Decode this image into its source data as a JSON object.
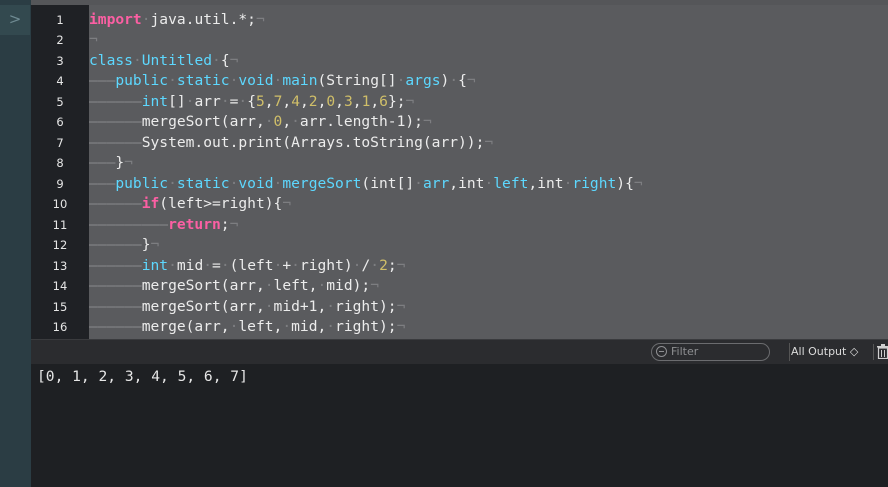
{
  "left_rail": {
    "toggle_glyph": ">"
  },
  "editor": {
    "line_numbers": [
      "1",
      "2",
      "3",
      "4",
      "5",
      "6",
      "7",
      "8",
      "9",
      "10",
      "11",
      "12",
      "13",
      "14",
      "15",
      "16"
    ],
    "lines": [
      [
        {
          "t": "import",
          "c": "kw"
        },
        {
          "t": "·",
          "c": "inv"
        },
        {
          "t": "java.util.*;",
          "c": ""
        },
        {
          "t": "¬",
          "c": "inv"
        }
      ],
      [
        {
          "t": "¬",
          "c": "inv"
        }
      ],
      [
        {
          "t": "class",
          "c": "kw2"
        },
        {
          "t": "·",
          "c": "inv"
        },
        {
          "t": "Untitled",
          "c": "kw2"
        },
        {
          "t": "·",
          "c": "inv"
        },
        {
          "t": "{",
          "c": ""
        },
        {
          "t": "¬",
          "c": "inv"
        }
      ],
      [
        {
          "t": "———",
          "c": "guide"
        },
        {
          "t": "public",
          "c": "kw2"
        },
        {
          "t": "·",
          "c": "inv"
        },
        {
          "t": "static",
          "c": "kw2"
        },
        {
          "t": "·",
          "c": "inv"
        },
        {
          "t": "void",
          "c": "kw2"
        },
        {
          "t": "·",
          "c": "inv"
        },
        {
          "t": "main",
          "c": "kw2"
        },
        {
          "t": "(String[]",
          "c": ""
        },
        {
          "t": "·",
          "c": "inv"
        },
        {
          "t": "args",
          "c": "kw2"
        },
        {
          "t": ")",
          "c": ""
        },
        {
          "t": "·",
          "c": "inv"
        },
        {
          "t": "{",
          "c": ""
        },
        {
          "t": "¬",
          "c": "inv"
        }
      ],
      [
        {
          "t": "——————",
          "c": "guide"
        },
        {
          "t": "int",
          "c": "kw2"
        },
        {
          "t": "[]",
          "c": ""
        },
        {
          "t": "·",
          "c": "inv"
        },
        {
          "t": "arr",
          "c": ""
        },
        {
          "t": "·",
          "c": "inv"
        },
        {
          "t": "=",
          "c": ""
        },
        {
          "t": "·",
          "c": "inv"
        },
        {
          "t": "{",
          "c": ""
        },
        {
          "t": "5",
          "c": "num-lit"
        },
        {
          "t": ",",
          "c": ""
        },
        {
          "t": "7",
          "c": "num-lit"
        },
        {
          "t": ",",
          "c": ""
        },
        {
          "t": "4",
          "c": "num-lit"
        },
        {
          "t": ",",
          "c": ""
        },
        {
          "t": "2",
          "c": "num-lit"
        },
        {
          "t": ",",
          "c": ""
        },
        {
          "t": "0",
          "c": "num-lit"
        },
        {
          "t": ",",
          "c": ""
        },
        {
          "t": "3",
          "c": "num-lit"
        },
        {
          "t": ",",
          "c": ""
        },
        {
          "t": "1",
          "c": "num-lit"
        },
        {
          "t": ",",
          "c": ""
        },
        {
          "t": "6",
          "c": "num-lit"
        },
        {
          "t": "};",
          "c": ""
        },
        {
          "t": "¬",
          "c": "inv"
        }
      ],
      [
        {
          "t": "——————",
          "c": "guide"
        },
        {
          "t": "mergeSort(arr,",
          "c": ""
        },
        {
          "t": "·",
          "c": "inv"
        },
        {
          "t": "0",
          "c": "num-lit"
        },
        {
          "t": ",",
          "c": ""
        },
        {
          "t": "·",
          "c": "inv"
        },
        {
          "t": "arr.length-1);",
          "c": ""
        },
        {
          "t": "¬",
          "c": "inv"
        }
      ],
      [
        {
          "t": "——————",
          "c": "guide"
        },
        {
          "t": "System.out.print(Arrays.toString(arr));",
          "c": ""
        },
        {
          "t": "¬",
          "c": "inv"
        }
      ],
      [
        {
          "t": "———",
          "c": "guide"
        },
        {
          "t": "}",
          "c": ""
        },
        {
          "t": "¬",
          "c": "inv"
        }
      ],
      [
        {
          "t": "———",
          "c": "guide"
        },
        {
          "t": "public",
          "c": "kw2"
        },
        {
          "t": "·",
          "c": "inv"
        },
        {
          "t": "static",
          "c": "kw2"
        },
        {
          "t": "·",
          "c": "inv"
        },
        {
          "t": "void",
          "c": "kw2"
        },
        {
          "t": "·",
          "c": "inv"
        },
        {
          "t": "mergeSort",
          "c": "kw2"
        },
        {
          "t": "(int[]",
          "c": ""
        },
        {
          "t": "·",
          "c": "inv"
        },
        {
          "t": "arr",
          "c": "kw2"
        },
        {
          "t": ",int",
          "c": ""
        },
        {
          "t": "·",
          "c": "inv"
        },
        {
          "t": "left",
          "c": "kw2"
        },
        {
          "t": ",int",
          "c": ""
        },
        {
          "t": "·",
          "c": "inv"
        },
        {
          "t": "right",
          "c": "kw2"
        },
        {
          "t": "){",
          "c": ""
        },
        {
          "t": "¬",
          "c": "inv"
        }
      ],
      [
        {
          "t": "——————",
          "c": "guide"
        },
        {
          "t": "if",
          "c": "kw"
        },
        {
          "t": "(left>=right){",
          "c": ""
        },
        {
          "t": "¬",
          "c": "inv"
        }
      ],
      [
        {
          "t": "—————————",
          "c": "guide"
        },
        {
          "t": "return",
          "c": "kw"
        },
        {
          "t": ";",
          "c": ""
        },
        {
          "t": "¬",
          "c": "inv"
        }
      ],
      [
        {
          "t": "——————",
          "c": "guide"
        },
        {
          "t": "}",
          "c": ""
        },
        {
          "t": "¬",
          "c": "inv"
        }
      ],
      [
        {
          "t": "——————",
          "c": "guide"
        },
        {
          "t": "int",
          "c": "kw2"
        },
        {
          "t": "·",
          "c": "inv"
        },
        {
          "t": "mid",
          "c": ""
        },
        {
          "t": "·",
          "c": "inv"
        },
        {
          "t": "=",
          "c": ""
        },
        {
          "t": "·",
          "c": "inv"
        },
        {
          "t": "(left",
          "c": ""
        },
        {
          "t": "·",
          "c": "inv"
        },
        {
          "t": "+",
          "c": ""
        },
        {
          "t": "·",
          "c": "inv"
        },
        {
          "t": "right)",
          "c": ""
        },
        {
          "t": "·",
          "c": "inv"
        },
        {
          "t": "/",
          "c": ""
        },
        {
          "t": "·",
          "c": "inv"
        },
        {
          "t": "2",
          "c": "num-lit"
        },
        {
          "t": ";",
          "c": ""
        },
        {
          "t": "¬",
          "c": "inv"
        }
      ],
      [
        {
          "t": "——————",
          "c": "guide"
        },
        {
          "t": "mergeSort(arr,",
          "c": ""
        },
        {
          "t": "·",
          "c": "inv"
        },
        {
          "t": "left,",
          "c": ""
        },
        {
          "t": "·",
          "c": "inv"
        },
        {
          "t": "mid);",
          "c": ""
        },
        {
          "t": "¬",
          "c": "inv"
        }
      ],
      [
        {
          "t": "——————",
          "c": "guide"
        },
        {
          "t": "mergeSort(arr,",
          "c": ""
        },
        {
          "t": "·",
          "c": "inv"
        },
        {
          "t": "mid+1,",
          "c": ""
        },
        {
          "t": "·",
          "c": "inv"
        },
        {
          "t": "right);",
          "c": ""
        },
        {
          "t": "¬",
          "c": "inv"
        }
      ],
      [
        {
          "t": "——————",
          "c": "guide"
        },
        {
          "t": "merge(arr,",
          "c": ""
        },
        {
          "t": "·",
          "c": "inv"
        },
        {
          "t": "left,",
          "c": ""
        },
        {
          "t": "·",
          "c": "inv"
        },
        {
          "t": "mid,",
          "c": ""
        },
        {
          "t": "·",
          "c": "inv"
        },
        {
          "t": "right);",
          "c": ""
        },
        {
          "t": "¬",
          "c": "inv"
        }
      ]
    ]
  },
  "console_toolbar": {
    "filter_placeholder": "Filter",
    "output_select": "All Output ◇",
    "trash_icon": "trash-icon",
    "filter_icon": "filter-icon"
  },
  "console": {
    "output": "[0, 1, 2, 3, 4, 5, 6, 7]"
  }
}
